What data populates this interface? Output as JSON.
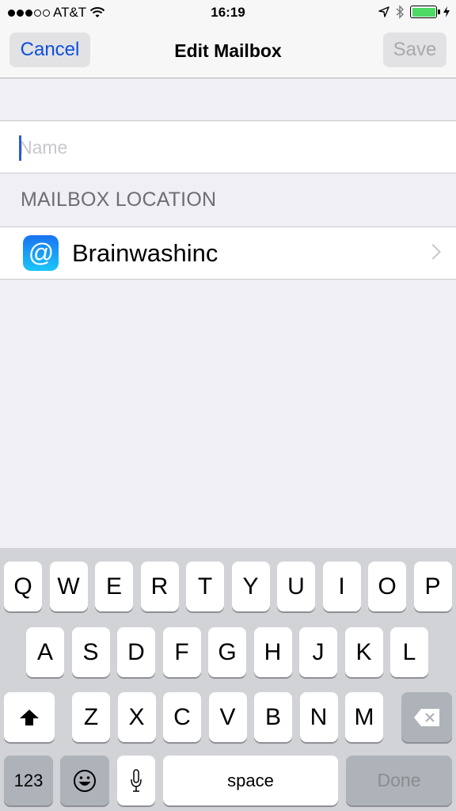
{
  "status_bar": {
    "signal_strength": 3,
    "signal_max": 5,
    "carrier": "AT&T",
    "time": "16:19",
    "battery_percent": 100,
    "charging": true,
    "icons": [
      "location-arrow-icon",
      "bluetooth-icon",
      "battery-icon",
      "charging-bolt-icon"
    ]
  },
  "nav": {
    "cancel_label": "Cancel",
    "title": "Edit Mailbox",
    "save_label": "Save",
    "save_enabled": false
  },
  "name_field": {
    "value": "",
    "placeholder": "Name"
  },
  "mailbox_location": {
    "header": "MAILBOX LOCATION",
    "account_label": "Brainwashinc",
    "icon_glyph": "@"
  },
  "keyboard": {
    "row1": [
      "Q",
      "W",
      "E",
      "R",
      "T",
      "Y",
      "U",
      "I",
      "O",
      "P"
    ],
    "row2": [
      "A",
      "S",
      "D",
      "F",
      "G",
      "H",
      "J",
      "K",
      "L"
    ],
    "row3": [
      "Z",
      "X",
      "C",
      "V",
      "B",
      "N",
      "M"
    ],
    "numbers_label": "123",
    "space_label": "space",
    "done_label": "Done",
    "shift_glyph": "⬆",
    "delete_glyph": "⌫",
    "emoji_glyph": "☺",
    "mic_glyph": "🎙"
  },
  "colors": {
    "accent": "#0b4fe0",
    "disabled": "#a9a9ab",
    "battery": "#4cd964"
  }
}
